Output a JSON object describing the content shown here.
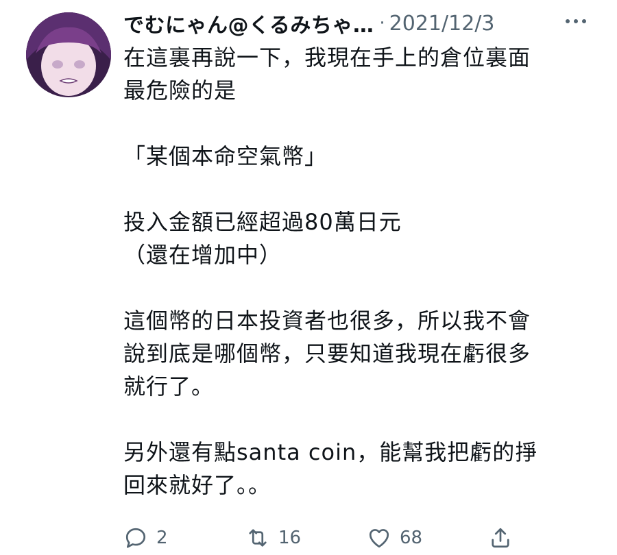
{
  "tweet": {
    "display_name": "でむにゃん@くるみちゃ…",
    "separator": "·",
    "date": "2021/12/3",
    "body": "在這裏再說一下，我現在手上的倉位裏面\n最危險的是\n\n「某個本命空氣幣」\n\n投入金額已經超過80萬日元\n（還在增加中）\n\n這個幣的日本投資者也很多，所以我不會\n說到底是哪個幣，只要知道我現在虧很多\n就行了。\n\n另外還有點santa coin，能幫我把虧的掙\n回來就好了。。",
    "reply_count": "2",
    "retweet_count": "16",
    "like_count": "68"
  },
  "icons": {
    "more": "more-horizontal-icon",
    "reply": "reply-icon",
    "retweet": "retweet-icon",
    "like": "heart-icon",
    "share": "share-icon"
  },
  "colors": {
    "text": "#0f1419",
    "secondary": "#536471"
  }
}
